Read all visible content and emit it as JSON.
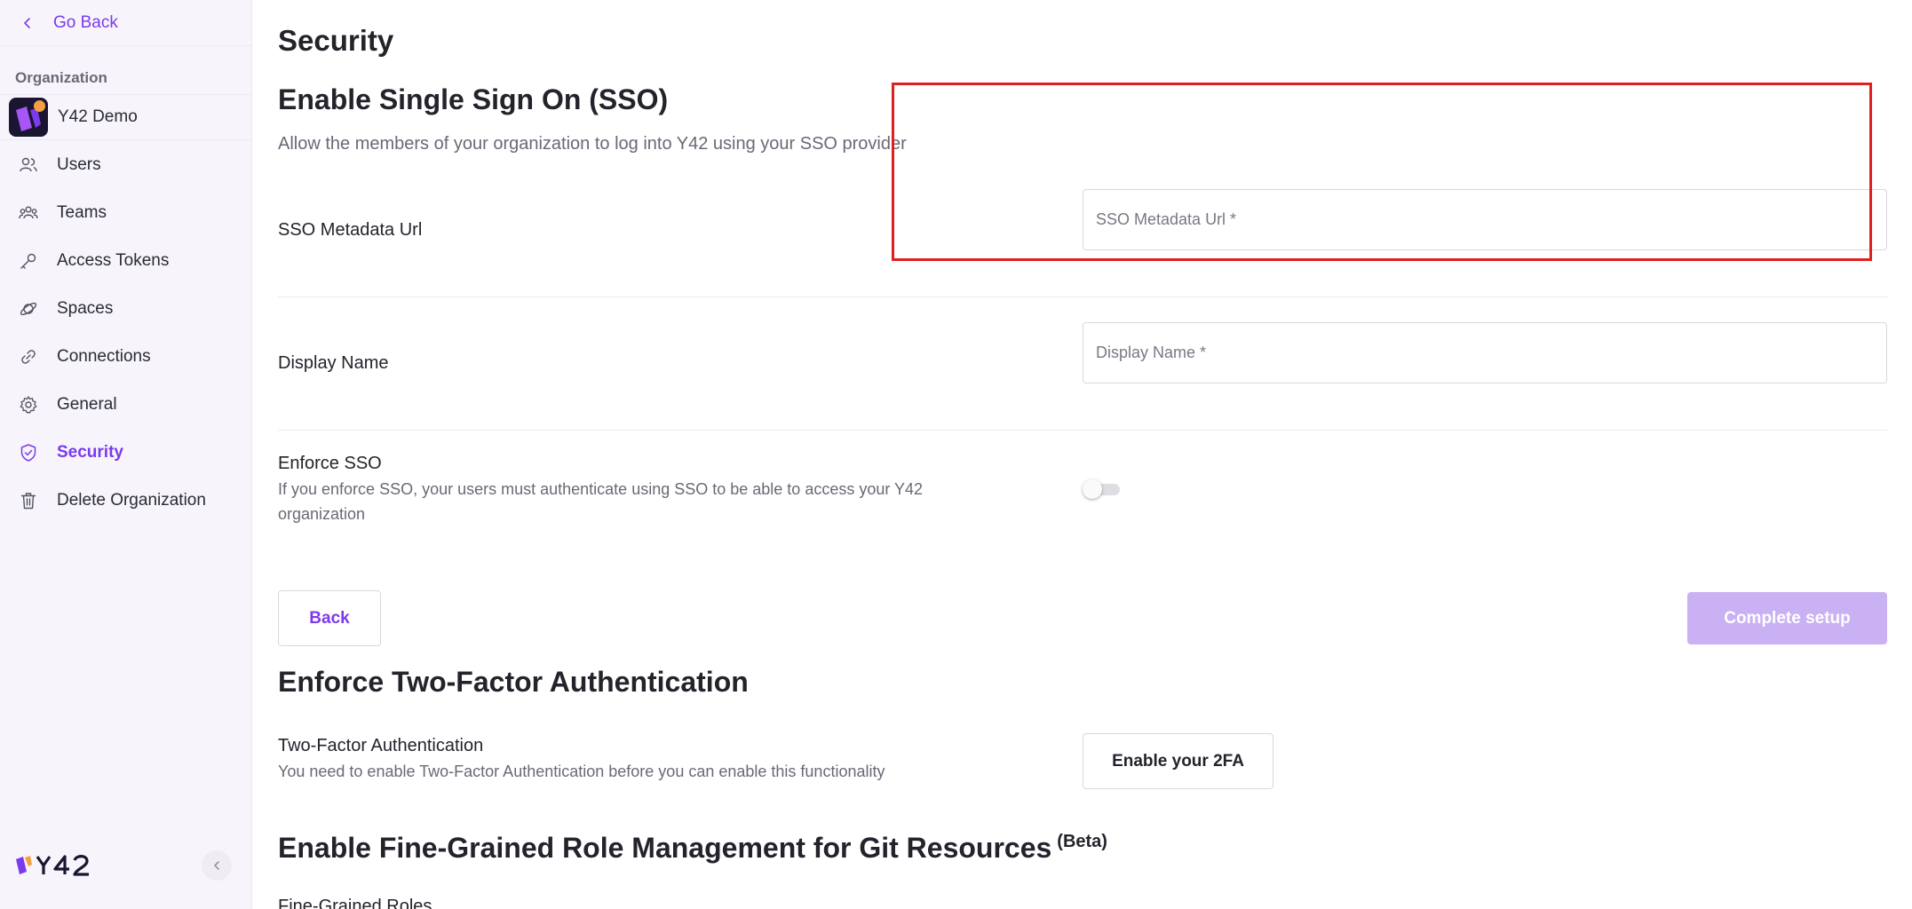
{
  "sidebar": {
    "back_label": "Go Back",
    "org_heading": "Organization",
    "org_name": "Y42 Demo",
    "items": [
      {
        "label": "Users",
        "icon": "users-icon"
      },
      {
        "label": "Teams",
        "icon": "teams-icon"
      },
      {
        "label": "Access Tokens",
        "icon": "key-icon"
      },
      {
        "label": "Spaces",
        "icon": "planet-icon"
      },
      {
        "label": "Connections",
        "icon": "link-icon"
      },
      {
        "label": "General",
        "icon": "gear-icon"
      },
      {
        "label": "Security",
        "icon": "shield-icon",
        "active": true
      },
      {
        "label": "Delete Organization",
        "icon": "trash-icon"
      }
    ],
    "brand": "Y42"
  },
  "main": {
    "page_title": "Security",
    "sso": {
      "heading": "Enable Single Sign On (SSO)",
      "subtitle": "Allow the members of your organization to log into Y42 using your SSO provider",
      "metadata_label": "SSO Metadata Url",
      "metadata_placeholder": "SSO Metadata Url *",
      "display_label": "Display Name",
      "display_placeholder": "Display Name *",
      "enforce_label": "Enforce SSO",
      "enforce_desc": "If you enforce SSO, your users must authenticate using SSO to be able to access your Y42 organization",
      "enforce_enabled": false,
      "back_button": "Back",
      "complete_button": "Complete setup"
    },
    "two_factor": {
      "heading": "Enforce Two-Factor Authentication",
      "label": "Two-Factor Authentication",
      "desc": "You need to enable Two-Factor Authentication before you can enable this functionality",
      "button": "Enable your 2FA"
    },
    "fine_grained": {
      "heading": "Enable Fine-Grained Role Management for Git Resources",
      "badge": "(Beta)",
      "label": "Fine-Grained Roles"
    }
  },
  "colors": {
    "accent": "#7c3aed",
    "accent_disabled": "#c4a9f3",
    "highlight": "#e0201e",
    "sidebar_bg": "#f7f5fb"
  }
}
